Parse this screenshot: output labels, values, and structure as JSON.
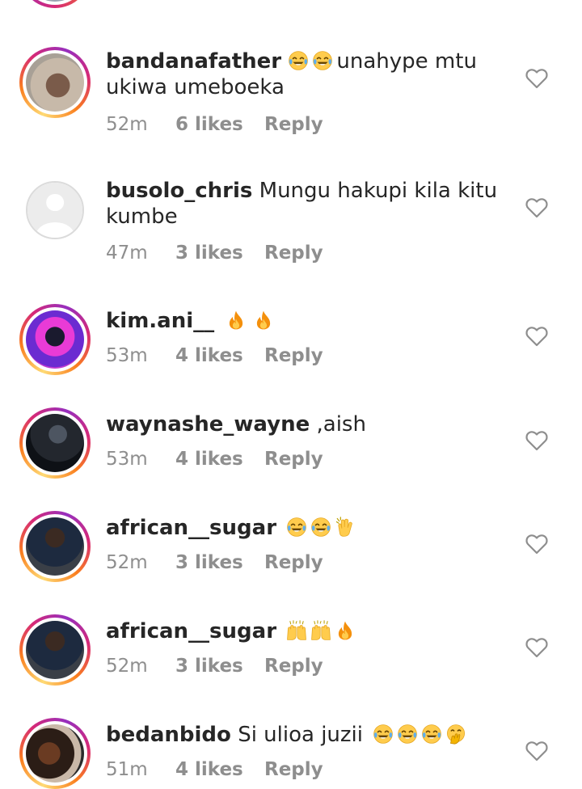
{
  "comments": [
    {
      "username": "bandanafather",
      "emojis": [
        "joy",
        "joy"
      ],
      "text": "unahype mtu ukiwa umeboeka",
      "time": "52m",
      "likes": "6 likes",
      "reply": "Reply",
      "avatar": "story"
    },
    {
      "username": "busolo_chris",
      "emojis": [],
      "text": "Mungu hakupi kila kitu kumbe",
      "time": "47m",
      "likes": "3 likes",
      "reply": "Reply",
      "avatar": "default"
    },
    {
      "username": "kim.ani__",
      "emojis": [
        "fire",
        "fire"
      ],
      "text": "",
      "time": "53m",
      "likes": "4 likes",
      "reply": "Reply",
      "avatar": "story"
    },
    {
      "username": "waynashe_wayne",
      "emojis": [],
      "text": ",aish",
      "time": "53m",
      "likes": "4 likes",
      "reply": "Reply",
      "avatar": "story"
    },
    {
      "username": "african__sugar",
      "emojis": [
        "joy",
        "joy",
        "clap"
      ],
      "text": "",
      "time": "52m",
      "likes": "3 likes",
      "reply": "Reply",
      "avatar": "story"
    },
    {
      "username": "african__sugar",
      "emojis": [
        "raised-hands",
        "raised-hands",
        "fire"
      ],
      "text": "",
      "time": "52m",
      "likes": "3 likes",
      "reply": "Reply",
      "avatar": "story"
    },
    {
      "username": "bedanbido",
      "emojis_after_text": [
        "joy",
        "joy",
        "joy",
        "hand-over-mouth"
      ],
      "text": "Si ulioa juzii",
      "time": "51m",
      "likes": "4 likes",
      "reply": "Reply",
      "avatar": "story"
    }
  ],
  "colors": {
    "text": "#262626",
    "meta": "#8e8e8e",
    "heart": "#8e8e8e",
    "story_ring": [
      "#feda75",
      "#fa7e1e",
      "#d62976",
      "#962fbf"
    ]
  },
  "icons": [
    "heart-outline-icon",
    "joy-emoji-icon",
    "fire-emoji-icon",
    "clap-emoji-icon",
    "raised-hands-emoji-icon",
    "hand-over-mouth-emoji-icon"
  ]
}
